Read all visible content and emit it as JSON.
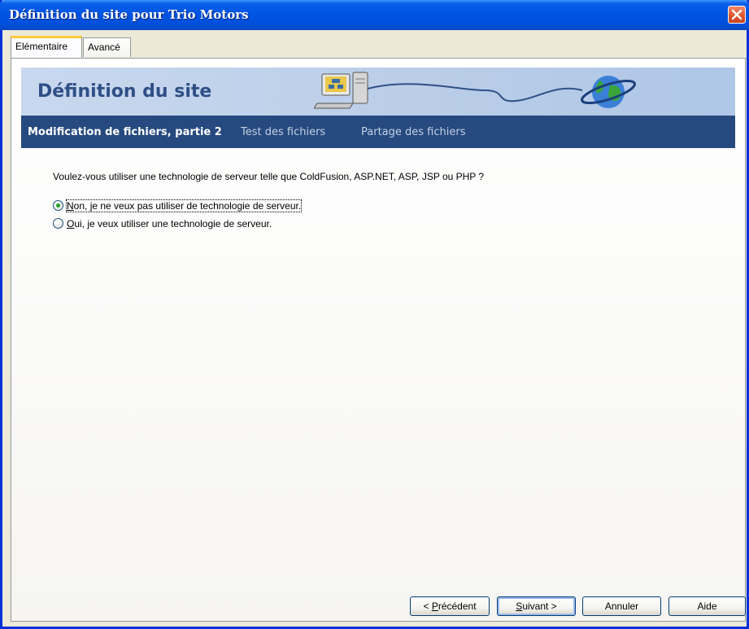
{
  "window": {
    "title": "Définition du site pour Trio Motors"
  },
  "tabs": [
    {
      "label": "Elémentaire",
      "active": true
    },
    {
      "label": "Avancé",
      "active": false
    }
  ],
  "banner": {
    "title": "Définition du site"
  },
  "steps": [
    {
      "label": "Modification de fichiers, partie 2",
      "current": true
    },
    {
      "label": "Test des fichiers",
      "current": false
    },
    {
      "label": "Partage des fichiers",
      "current": false
    }
  ],
  "question": "Voulez-vous utiliser une technologie de serveur telle que ColdFusion, ASP.NET, ASP, JSP ou PHP ?",
  "options": [
    {
      "mnemonic": "N",
      "rest": "on, je ne veux pas utiliser de technologie de serveur.",
      "selected": true
    },
    {
      "mnemonic": "O",
      "rest": "ui, je veux utiliser une technologie de serveur.",
      "selected": false
    }
  ],
  "buttons": {
    "back": {
      "prefix": "< ",
      "mnemonic": "P",
      "rest": "récédent"
    },
    "next": {
      "mnemonic": "S",
      "rest": "uivant >"
    },
    "cancel": "Annuler",
    "help": "Aide"
  },
  "colors": {
    "titlebar": "#0054e3",
    "step_bar": "#264a7f",
    "banner_title": "#2f4f86",
    "radio_dot": "#21a121"
  },
  "icons": {
    "close": "close-icon",
    "banner_computer": "computer-icon",
    "banner_globe": "globe-icon"
  }
}
